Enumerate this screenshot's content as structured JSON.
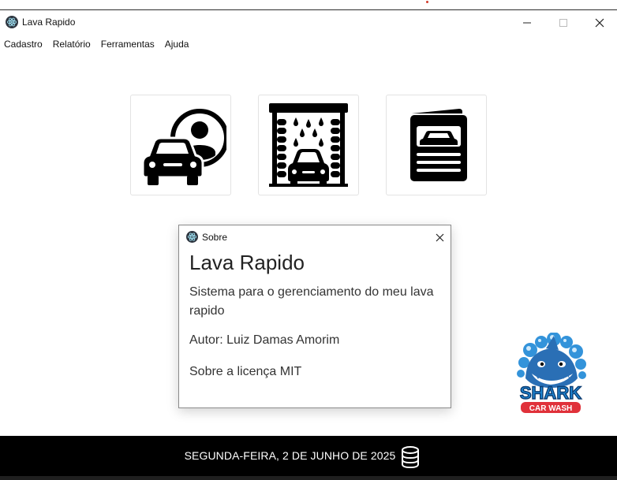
{
  "window": {
    "title": "Lava Rapido",
    "app_icon": "electron-atom-icon"
  },
  "menu": {
    "items": [
      "Cadastro",
      "Relatório",
      "Ferramentas",
      "Ajuda"
    ]
  },
  "tiles": [
    {
      "icon": "customer-car-icon"
    },
    {
      "icon": "car-wash-icon"
    },
    {
      "icon": "vehicle-document-icon"
    }
  ],
  "dialog": {
    "title": "Sobre",
    "heading": "Lava Rapido",
    "description": "Sistema para o gerenciamento do meu lava rapido",
    "author": "Autor: Luiz Damas Amorim",
    "license": "Sobre a licença MIT"
  },
  "logo": {
    "line1": "SHARK",
    "line2": "CAR WASH"
  },
  "footer": {
    "date": "SEGUNDA-FEIRA, 2 DE JUNHO DE 2025",
    "icon": "database-icon"
  },
  "colors": {
    "footer_bg": "#000000",
    "logo_blue": "#1e88d6",
    "logo_red": "#e0313a"
  }
}
